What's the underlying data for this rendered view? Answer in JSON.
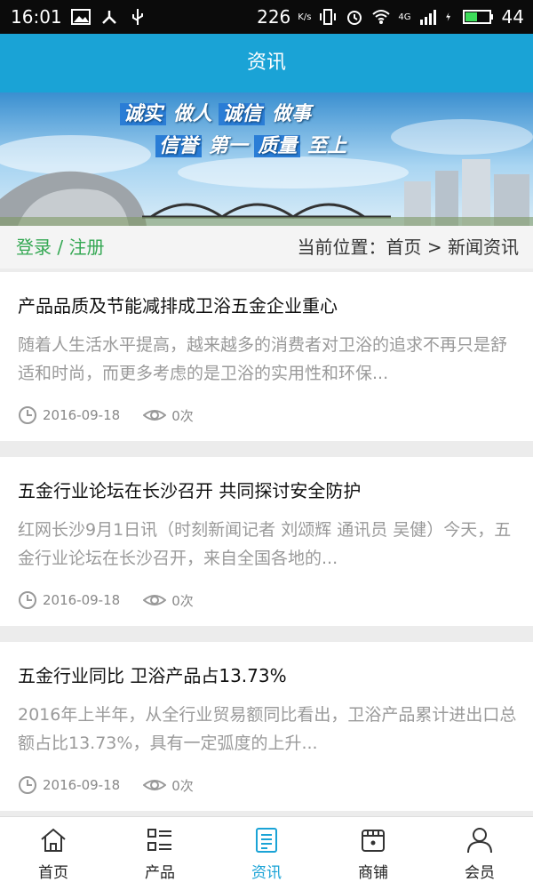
{
  "status": {
    "time": "16:01",
    "speed": "226",
    "speed_unit": "K/s",
    "net": "4G",
    "battery": "44"
  },
  "header": {
    "title": "资讯"
  },
  "banner": {
    "line1": [
      "诚实",
      "做人",
      "诚信",
      "做事"
    ],
    "line2": [
      "信誉",
      "第一",
      "质量",
      "至上"
    ]
  },
  "location": {
    "login": "登录 / 注册",
    "breadcrumb": "当前位置：首页 > 新闻资讯"
  },
  "articles": [
    {
      "title": "产品品质及节能减排成卫浴五金企业重心",
      "summary": "随着人生活水平提高，越来越多的消费者对卫浴的追求不再只是舒适和时尚，而更多考虑的是卫浴的实用性和环保...",
      "date": "2016-09-18",
      "views": "0次"
    },
    {
      "title": "五金行业论坛在长沙召开 共同探讨安全防护",
      "summary": "红网长沙9月1日讯（时刻新闻记者 刘颂辉 通讯员 吴健）今天，五金行业论坛在长沙召开，来自全国各地的...",
      "date": "2016-09-18",
      "views": "0次"
    },
    {
      "title": "五金行业同比 卫浴产品占13.73%",
      "summary": "2016年上半年，从全行业贸易额同比看出，卫浴产品累计进出口总额占比13.73%，具有一定弧度的上升...",
      "date": "2016-09-18",
      "views": "0次"
    }
  ],
  "tabs": [
    {
      "label": "首页",
      "icon": "home-icon"
    },
    {
      "label": "产品",
      "icon": "list-icon"
    },
    {
      "label": "资讯",
      "icon": "news-icon",
      "active": true
    },
    {
      "label": "商铺",
      "icon": "shop-icon"
    },
    {
      "label": "会员",
      "icon": "user-icon"
    }
  ],
  "colors": {
    "accent": "#1aa3d6",
    "login": "#34a853"
  }
}
